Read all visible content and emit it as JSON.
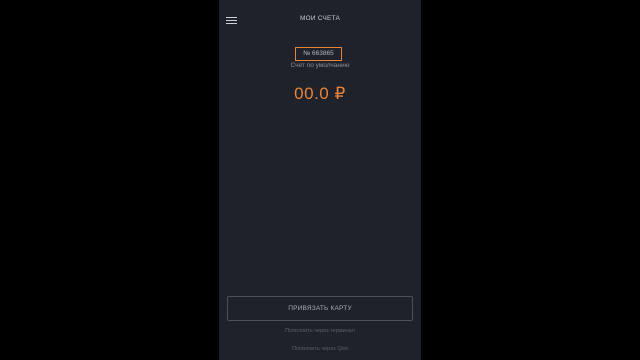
{
  "header": {
    "title": "МОИ СЧЕТА",
    "menu_icon": "hamburger-menu-icon"
  },
  "account": {
    "number": "№ 663865",
    "caption": "Счет по умолчанию",
    "balance": "00.0 ₽"
  },
  "actions": {
    "link_card_label": "ПРИВЯЗАТЬ КАРТУ",
    "link_1": "Пополнить через терминал",
    "link_2": "Пополнить через Qiwi"
  },
  "colors": {
    "accent": "#e8843a",
    "screen_background": "#1f222a",
    "outer_background": "#000000"
  }
}
